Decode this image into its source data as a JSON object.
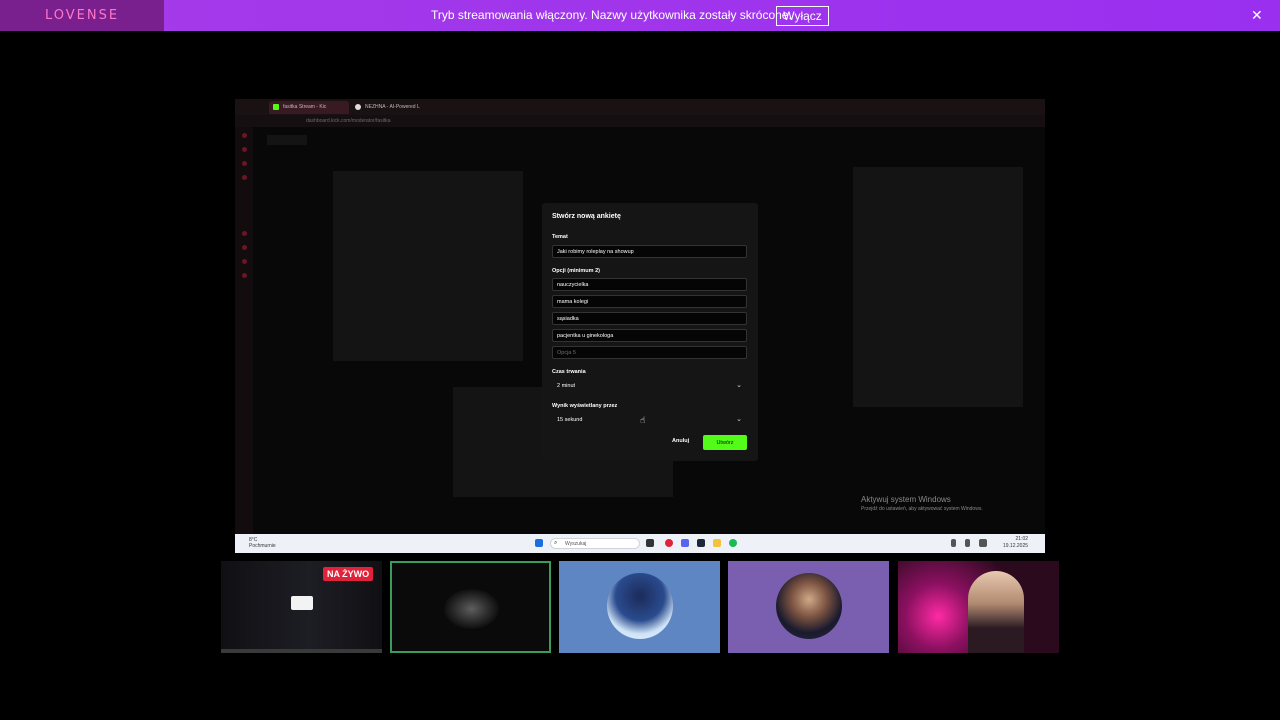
{
  "banner": {
    "logo": "LOVENSE",
    "message": "Tryb streamowania włączony. Nazwy użytkownika zostały skrócone.",
    "off_button": "Wyłącz",
    "close_glyph": "✕"
  },
  "browser": {
    "tabs": [
      {
        "label": "fasitka Stream - Kic"
      },
      {
        "label": "NEZHNA - AI-Powered L"
      }
    ],
    "url": "dashboard.kick.com/moderator/fasitka"
  },
  "poll_modal": {
    "title": "Stwórz nową ankietę",
    "topic_label": "Temat",
    "topic_value": "Jaki robimy roleplay na showup",
    "options_label": "Opcji (minimum 2)",
    "options": [
      {
        "value": "nauczycielka",
        "placeholder": ""
      },
      {
        "value": "mama kolegi",
        "placeholder": ""
      },
      {
        "value": "sąsiadka",
        "placeholder": ""
      },
      {
        "value": "pacjentka u ginekologa",
        "placeholder": ""
      },
      {
        "value": "",
        "placeholder": "Opcja 5"
      }
    ],
    "duration_label": "Czas trwania",
    "duration_value": "2 minut",
    "result_label": "Wynik wyświetlany przez",
    "result_value": "15 sekund",
    "cancel_label": "Anuluj",
    "create_label": "Utwórz"
  },
  "taskbar": {
    "weather_temp": "8°C",
    "weather_desc": "Pochmurnie",
    "search_placeholder": "Wyszukaj",
    "time": "21:02",
    "date": "19.12.2025"
  },
  "windows_watermark": {
    "line1": "Aktywuj system Windows",
    "line2": "Przejdź do ustawień, aby aktywować system Windows."
  },
  "webcams": {
    "live_badge": "NA ŻYWO"
  },
  "colors": {
    "banner_purple": "#9a2ff0",
    "kick_green": "#53fc18",
    "live_red": "#e0223a"
  }
}
